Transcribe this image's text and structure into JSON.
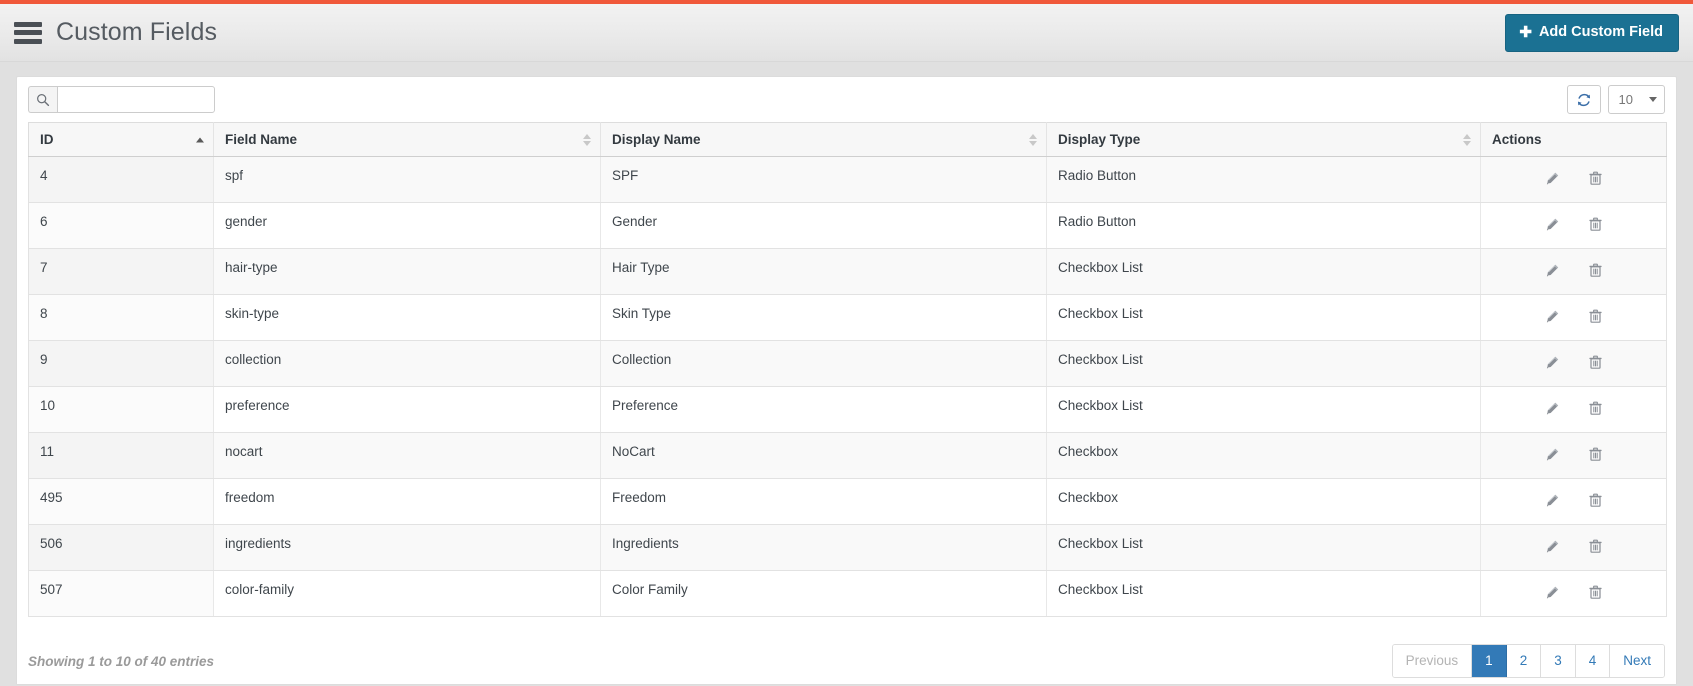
{
  "header": {
    "title": "Custom Fields",
    "menu_icon": "hamburger-menu-icon",
    "add_button_label": "Add Custom Field",
    "add_button_icon": "plus-icon",
    "accent_color": "#f0583a",
    "add_button_color": "#1b7193"
  },
  "toolbar": {
    "search_placeholder": "",
    "search_value": "",
    "search_icon": "search-icon",
    "refresh_icon": "refresh-icon",
    "page_length_value": "10"
  },
  "table": {
    "columns": [
      {
        "label": "ID",
        "sort": "asc"
      },
      {
        "label": "Field Name",
        "sort": "none"
      },
      {
        "label": "Display Name",
        "sort": "none"
      },
      {
        "label": "Display Type",
        "sort": "none"
      },
      {
        "label": "Actions",
        "sort": null
      }
    ],
    "rows": [
      {
        "id": "4",
        "field_name": "spf",
        "display_name": "SPF",
        "display_type": "Radio Button"
      },
      {
        "id": "6",
        "field_name": "gender",
        "display_name": "Gender",
        "display_type": "Radio Button"
      },
      {
        "id": "7",
        "field_name": "hair-type",
        "display_name": "Hair Type",
        "display_type": "Checkbox List"
      },
      {
        "id": "8",
        "field_name": "skin-type",
        "display_name": "Skin Type",
        "display_type": "Checkbox List"
      },
      {
        "id": "9",
        "field_name": "collection",
        "display_name": "Collection",
        "display_type": "Checkbox List"
      },
      {
        "id": "10",
        "field_name": "preference",
        "display_name": "Preference",
        "display_type": "Checkbox List"
      },
      {
        "id": "11",
        "field_name": "nocart",
        "display_name": "NoCart",
        "display_type": "Checkbox"
      },
      {
        "id": "495",
        "field_name": "freedom",
        "display_name": "Freedom",
        "display_type": "Checkbox"
      },
      {
        "id": "506",
        "field_name": "ingredients",
        "display_name": "Ingredients",
        "display_type": "Checkbox List"
      },
      {
        "id": "507",
        "field_name": "color-family",
        "display_name": "Color Family",
        "display_type": "Checkbox List"
      }
    ],
    "row_actions": [
      {
        "name": "edit-icon",
        "title": "Edit"
      },
      {
        "name": "delete-icon",
        "title": "Delete"
      }
    ]
  },
  "footer": {
    "entries_info": "Showing 1 to 10 of 40 entries",
    "pagination": {
      "previous_label": "Previous",
      "next_label": "Next",
      "pages": [
        "1",
        "2",
        "3",
        "4"
      ],
      "active_page": "1",
      "active_color": "#337ab7"
    }
  }
}
